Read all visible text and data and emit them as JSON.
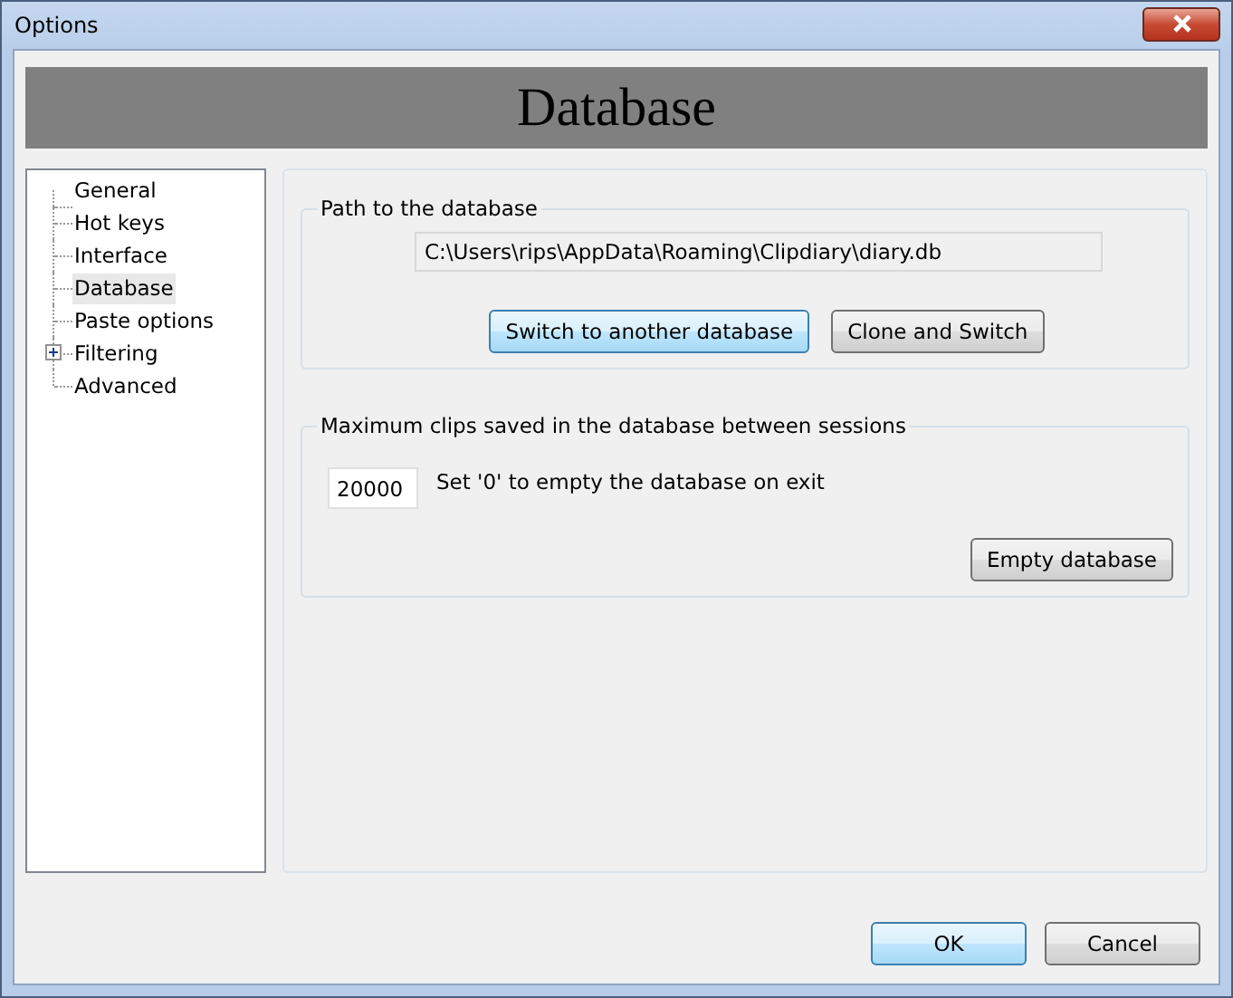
{
  "window": {
    "title": "Options"
  },
  "header": {
    "title": "Database"
  },
  "tree": {
    "items": [
      {
        "label": "General",
        "selected": false
      },
      {
        "label": "Hot keys",
        "selected": false
      },
      {
        "label": "Interface",
        "selected": false
      },
      {
        "label": "Database",
        "selected": true
      },
      {
        "label": "Paste options",
        "selected": false
      },
      {
        "label": "Filtering",
        "selected": false,
        "expanded": false
      },
      {
        "label": "Advanced",
        "selected": false
      }
    ]
  },
  "path_group": {
    "legend": "Path to the database",
    "path": "C:\\Users\\rips\\AppData\\Roaming\\Clipdiary\\diary.db",
    "buttons": [
      {
        "label": "Switch to another database",
        "focused": true
      },
      {
        "label": "Clone and Switch",
        "focused": false
      }
    ]
  },
  "clips_group": {
    "legend": "Maximum clips saved in the database between sessions",
    "value": "20000",
    "hint": "Set '0' to empty the database on exit",
    "button": "Empty database"
  },
  "buttons": [
    {
      "label": "OK",
      "default": true
    },
    {
      "label": "Cancel",
      "default": false
    }
  ]
}
